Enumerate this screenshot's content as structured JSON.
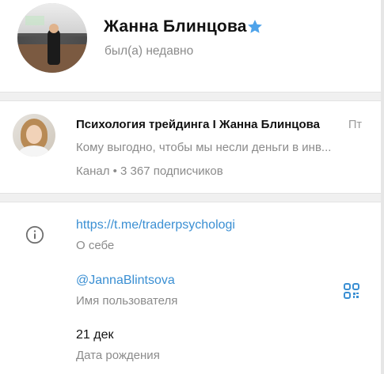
{
  "profile": {
    "name": "Жанна Блинцова",
    "status": "был(а) недавно",
    "verified_icon": "star-icon",
    "accent_color": "#3a8fd3"
  },
  "channel": {
    "title": "Психология трейдинга I Жанна Блинцова",
    "day": "Пт",
    "preview": "Кому выгодно, чтобы мы несли деньги в инв...",
    "meta": "Канал • 3 367 подписчиков"
  },
  "info": {
    "link": "https://t.me/traderpsychologi",
    "link_label": "О себе",
    "username": "@JannaBlintsova",
    "username_label": "Имя пользователя",
    "birthday": "21 дек",
    "birthday_label": "Дата рождения",
    "icons": [
      "info-icon",
      "qr-code-icon"
    ]
  }
}
